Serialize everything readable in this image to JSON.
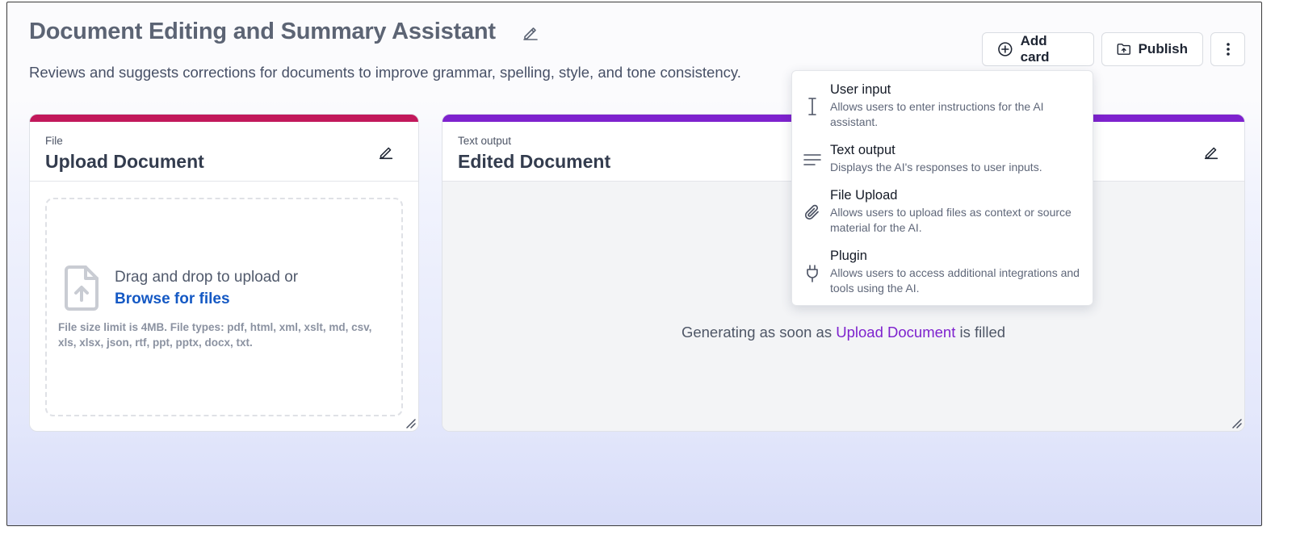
{
  "header": {
    "title": "Document Editing and Summary Assistant",
    "description": "Reviews and suggests corrections for documents to improve grammar, spelling, style, and tone consistency."
  },
  "toolbar": {
    "add_card_label": "Add card",
    "publish_label": "Publish"
  },
  "cards": [
    {
      "kind": "File",
      "name": "Upload Document",
      "accent": "#c2185b",
      "dropzone": {
        "prompt": "Drag and drop to upload or",
        "browse_label": "Browse for files",
        "limit_text": "File size limit is 4MB. File types: pdf, html, xml, xslt, md, csv, xls, xlsx, json, rtf, ppt, pptx, docx, txt."
      }
    },
    {
      "kind": "Text output",
      "name": "Edited Document",
      "accent": "#7e22ce",
      "status_prefix": "Generating as soon as",
      "status_link": "Upload Document",
      "status_suffix": "is filled"
    }
  ],
  "add_card_menu": {
    "items": [
      {
        "label": "User input",
        "description": "Allows users to enter instructions for the AI assistant.",
        "icon": "text-cursor-icon"
      },
      {
        "label": "Text output",
        "description": "Displays the AI's responses to user inputs.",
        "icon": "lines-icon"
      },
      {
        "label": "File Upload",
        "description": "Allows users to upload files as context or source material for the AI.",
        "icon": "paperclip-icon"
      },
      {
        "label": "Plugin",
        "description": "Allows users to access additional integrations and tools using the AI.",
        "icon": "plug-icon"
      }
    ]
  },
  "colors": {
    "file_accent": "#c2185b",
    "text_output_accent": "#7e22ce",
    "link_blue": "#1559c4"
  }
}
